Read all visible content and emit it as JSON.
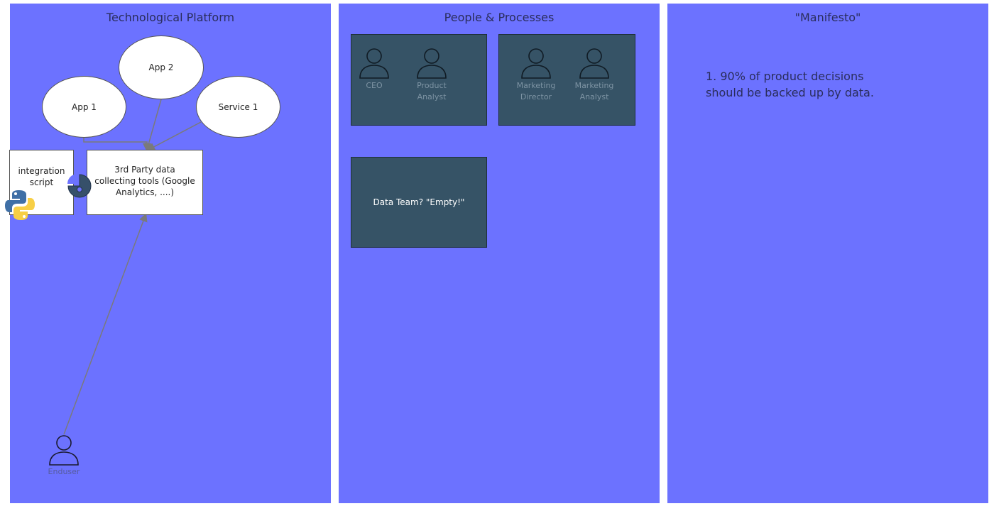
{
  "panels": {
    "tech": {
      "title": "Technological Platform",
      "nodes": {
        "app1": "App 1",
        "app2": "App 2",
        "service1": "Service 1",
        "integration_script": "integration script",
        "third_party": "3rd Party data collecting tools (Google Analytics, ....)",
        "enduser": "Enduser"
      }
    },
    "people": {
      "title": "People & Processes",
      "groups": [
        {
          "members": [
            "CEO",
            "Product Analyst"
          ]
        },
        {
          "members": [
            "Marketing Director",
            "Marketing Analyst"
          ]
        }
      ],
      "data_team": "Data Team? \"Empty!\""
    },
    "manifesto": {
      "title": "\"Manifesto\"",
      "items": [
        "1. 90% of product decisions should be backed up by data."
      ]
    }
  },
  "colors": {
    "panel_bg": "#6c72ff",
    "group_bg": "#365366",
    "arrow": "#7a7a7a"
  },
  "icons": {
    "person": "person-icon",
    "python": "python-logo-icon",
    "pie": "pie-chart-icon"
  }
}
